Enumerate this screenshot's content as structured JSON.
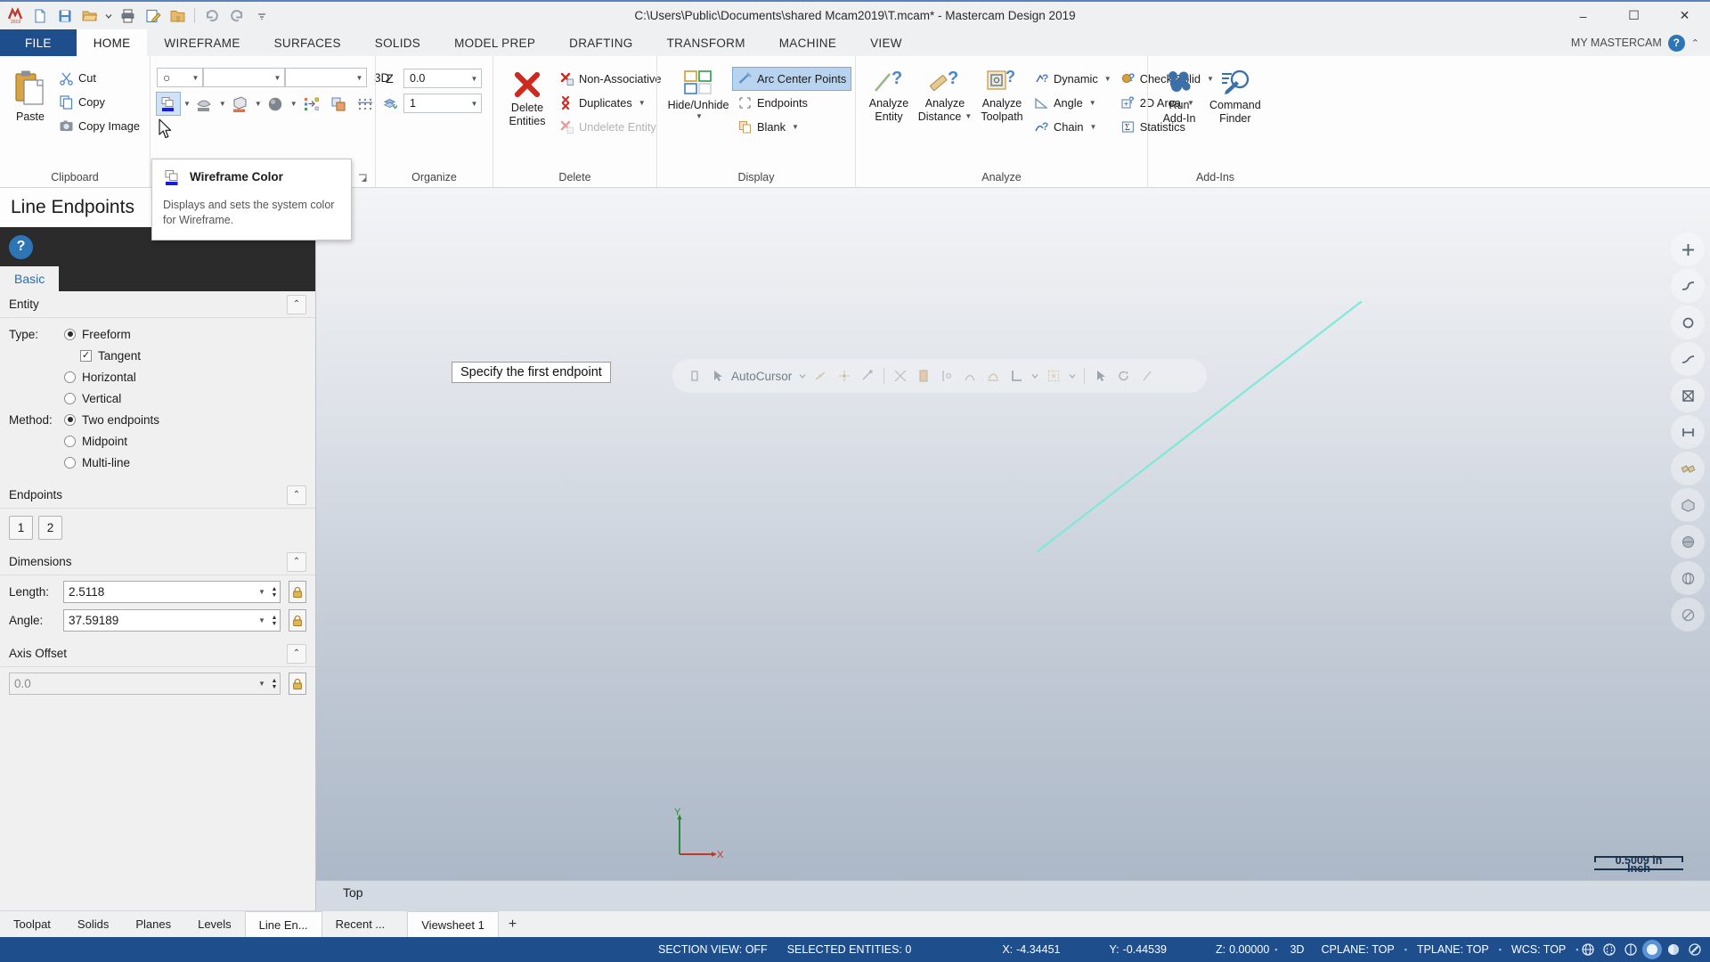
{
  "titlebar": {
    "document_path": "C:\\Users\\Public\\Documents\\shared Mcam2019\\T.mcam* - Mastercam Design 2019",
    "quick_access": [
      {
        "name": "mastercam-logo-icon",
        "label": "Mastercam"
      },
      {
        "name": "new-file-icon",
        "label": "New"
      },
      {
        "name": "save-icon",
        "label": "Save"
      },
      {
        "name": "open-folder-icon",
        "label": "Open"
      },
      {
        "name": "print-icon",
        "label": "Print"
      },
      {
        "name": "edit-file-icon",
        "label": "Edit"
      },
      {
        "name": "folder-icon",
        "label": "Folder"
      },
      {
        "name": "undo-icon",
        "label": "Undo"
      },
      {
        "name": "redo-icon",
        "label": "Redo"
      },
      {
        "name": "customize-qat-icon",
        "label": "Customize Quick Access Toolbar"
      }
    ],
    "window_controls": {
      "minimize": "–",
      "maximize": "☐",
      "close": "✕"
    }
  },
  "ribbon": {
    "tabs": [
      {
        "label": "FILE",
        "active": false,
        "kind": "file"
      },
      {
        "label": "HOME",
        "active": true
      },
      {
        "label": "WIREFRAME",
        "active": false
      },
      {
        "label": "SURFACES",
        "active": false
      },
      {
        "label": "SOLIDS",
        "active": false
      },
      {
        "label": "MODEL PREP",
        "active": false
      },
      {
        "label": "DRAFTING",
        "active": false
      },
      {
        "label": "TRANSFORM",
        "active": false
      },
      {
        "label": "MACHINE",
        "active": false
      },
      {
        "label": "VIEW",
        "active": false
      }
    ],
    "account_label": "MY MASTERCAM",
    "help_label": "?",
    "collapse_label": "⌃",
    "groups": {
      "clipboard": {
        "label": "Clipboard",
        "paste_label": "Paste",
        "items": [
          {
            "label": "Cut",
            "icon": "scissors-icon"
          },
          {
            "label": "Copy",
            "icon": "copy-icon"
          },
          {
            "label": "Copy Image",
            "icon": "camera-icon"
          }
        ]
      },
      "attributes": {
        "label": "Attributes",
        "color_value": "○",
        "line_style_value": "solid-line",
        "line_width_value": "thin-line",
        "depth_label": "3D",
        "buttons": [
          {
            "name": "wireframe-color-button",
            "icon": "wireframe-color-icon",
            "has_dropdown": true
          },
          {
            "name": "surface-color-button",
            "icon": "surface-color-icon",
            "has_dropdown": true
          },
          {
            "name": "solid-color-button",
            "icon": "solid-color-icon",
            "has_dropdown": true
          },
          {
            "name": "material-button",
            "icon": "shaded-sphere-icon",
            "has_dropdown": true
          },
          {
            "name": "set-all-attributes-button",
            "icon": "set-attributes-icon",
            "has_dropdown": false
          },
          {
            "name": "clear-colors-button",
            "icon": "clear-colors-icon",
            "has_dropdown": false
          },
          {
            "name": "grid-attributes-button",
            "icon": "grid-icon",
            "has_dropdown": false
          }
        ]
      },
      "organize": {
        "label": "Organize",
        "z_label": "Z",
        "z_value": "0.0",
        "level_icon": "levels-icon",
        "level_value": "1"
      },
      "delete": {
        "label": "Delete",
        "delete_entities_label": "Delete\nEntities",
        "delete_entities_line1": "Delete",
        "delete_entities_line2": "Entities",
        "items": [
          {
            "label": "Non-Associative",
            "icon": "non-associative-icon",
            "disabled": false,
            "dropdown": false
          },
          {
            "label": "Duplicates",
            "icon": "duplicates-icon",
            "disabled": false,
            "dropdown": true
          },
          {
            "label": "Undelete Entity",
            "icon": "undelete-icon",
            "disabled": true,
            "dropdown": false
          }
        ]
      },
      "display": {
        "label": "Display",
        "hide_unhide_line1": "Hide/Unhide",
        "items": [
          {
            "label": "Arc Center Points",
            "icon": "arc-center-points-icon",
            "selected": true,
            "dropdown": false
          },
          {
            "label": "Endpoints",
            "icon": "endpoints-icon",
            "selected": false,
            "dropdown": false
          },
          {
            "label": "Blank",
            "icon": "blank-icon",
            "selected": false,
            "dropdown": true
          }
        ]
      },
      "analyze": {
        "label": "Analyze",
        "big_buttons": [
          {
            "line1": "Analyze",
            "line2": "Entity",
            "icon": "analyze-entity-icon",
            "dropdown": false
          },
          {
            "line1": "Analyze",
            "line2": "Distance",
            "icon": "analyze-distance-icon",
            "dropdown": true
          },
          {
            "line1": "Analyze",
            "line2": "Toolpath",
            "icon": "analyze-toolpath-icon",
            "dropdown": false
          }
        ],
        "small_col1": [
          {
            "label": "Dynamic",
            "icon": "dynamic-icon",
            "dropdown": true
          },
          {
            "label": "Angle",
            "icon": "angle-icon",
            "dropdown": true
          },
          {
            "label": "Chain",
            "icon": "chain-icon",
            "dropdown": true
          }
        ],
        "small_col2": [
          {
            "label": "Check Solid",
            "icon": "check-solid-icon",
            "dropdown": true
          },
          {
            "label": "2D Area",
            "icon": "area-2d-icon",
            "dropdown": true
          },
          {
            "label": "Statistics",
            "icon": "statistics-icon",
            "dropdown": false
          }
        ]
      },
      "addins": {
        "label": "Add-Ins",
        "buttons": [
          {
            "line1": "Run",
            "line2": "Add-In",
            "icon": "run-addin-icon"
          },
          {
            "line1": "Command",
            "line2": "Finder",
            "icon": "command-finder-icon"
          }
        ]
      }
    }
  },
  "tooltip": {
    "title": "Wireframe Color",
    "body": "Displays and sets the system color for Wireframe.",
    "icon": "wireframe-color-icon"
  },
  "left_panel": {
    "title": "Line Endpoints",
    "help_label": "?",
    "tabs": [
      {
        "label": "Basic",
        "active": true
      }
    ],
    "sections": {
      "entity": {
        "title": "Entity",
        "type_label": "Type:",
        "method_label": "Method:",
        "type_options": [
          {
            "label": "Freeform",
            "selected": true
          },
          {
            "label": "Horizontal",
            "selected": false
          },
          {
            "label": "Vertical",
            "selected": false
          }
        ],
        "tangent": {
          "label": "Tangent",
          "checked": true
        },
        "method_options": [
          {
            "label": "Two endpoints",
            "selected": true
          },
          {
            "label": "Midpoint",
            "selected": false
          },
          {
            "label": "Multi-line",
            "selected": false
          }
        ]
      },
      "endpoints": {
        "title": "Endpoints",
        "buttons": [
          {
            "label": "1"
          },
          {
            "label": "2"
          }
        ]
      },
      "dimensions": {
        "title": "Dimensions",
        "fields": [
          {
            "label": "Length:",
            "value": "2.5118",
            "locked": true
          },
          {
            "label": "Angle:",
            "value": "37.59189",
            "locked": true
          }
        ]
      },
      "axis_offset": {
        "title": "Axis Offset",
        "value": "",
        "placeholder": "0.0",
        "locked": true,
        "disabled": true
      }
    }
  },
  "viewport": {
    "prompt": "Specify the first endpoint",
    "view_name": "Top",
    "scale_value": "0.5009 in",
    "scale_unit": "Inch",
    "axis_x_label": "X",
    "axis_y_label": "Y",
    "geometry_color": "#7fe8d8",
    "autocursor": {
      "label": "AutoCursor",
      "icons": [
        "origin-icon",
        "autocursor-arrow-icon",
        "autocursor-dropdown-icon",
        "midpoint-icon",
        "point-icon",
        "endpoint-icon",
        "intersection-icon",
        "center-icon",
        "quadrant-icon",
        "nearest-icon",
        "tangent-snap-icon",
        "perpendicular-icon",
        "relative-icon",
        "grid-snap-icon",
        "grid-dropdown-icon",
        "select-icon",
        "rotate-icon",
        "last-icon"
      ]
    },
    "right_rail": [
      "fit-icon",
      "zoom-window-icon",
      "zoom-target-icon",
      "dynamic-rotate-icon",
      "unzoom-icon",
      "pan-icon",
      "gview-icon",
      "isometric-icon",
      "shading-icon",
      "wireframe-view-icon",
      "no-shade-icon"
    ]
  },
  "bottom_tabs": [
    {
      "label": "Toolpat",
      "active": false
    },
    {
      "label": "Solids",
      "active": false
    },
    {
      "label": "Planes",
      "active": false
    },
    {
      "label": "Levels",
      "active": false
    },
    {
      "label": "Line En...",
      "active": true
    },
    {
      "label": "Recent ...",
      "active": false
    }
  ],
  "viewsheet_tabs": [
    {
      "label": "Viewsheet 1",
      "active": true
    },
    {
      "label": "+",
      "active": false
    }
  ],
  "status_bar": {
    "section_view": "SECTION VIEW: OFF",
    "selected_entities": "SELECTED ENTITIES: 0",
    "x_label": "X:",
    "x_value": "-4.34451",
    "y_label": "Y:",
    "y_value": "-0.44539",
    "z_label": "Z:",
    "z_value": "0.00000",
    "mode": "3D",
    "cplane": "CPLANE: TOP",
    "tplane": "TPLANE: TOP",
    "wcs": "WCS: TOP",
    "right_icons": [
      {
        "name": "wireframe-display-icon",
        "selected": false
      },
      {
        "name": "hidden-lines-icon",
        "selected": false
      },
      {
        "name": "shaded-wireframe-icon",
        "selected": false
      },
      {
        "name": "shaded-icon",
        "selected": true
      },
      {
        "name": "material-shade-icon",
        "selected": false
      },
      {
        "name": "translucent-icon",
        "selected": false
      }
    ],
    "accent_color": "#1f4e8c"
  }
}
